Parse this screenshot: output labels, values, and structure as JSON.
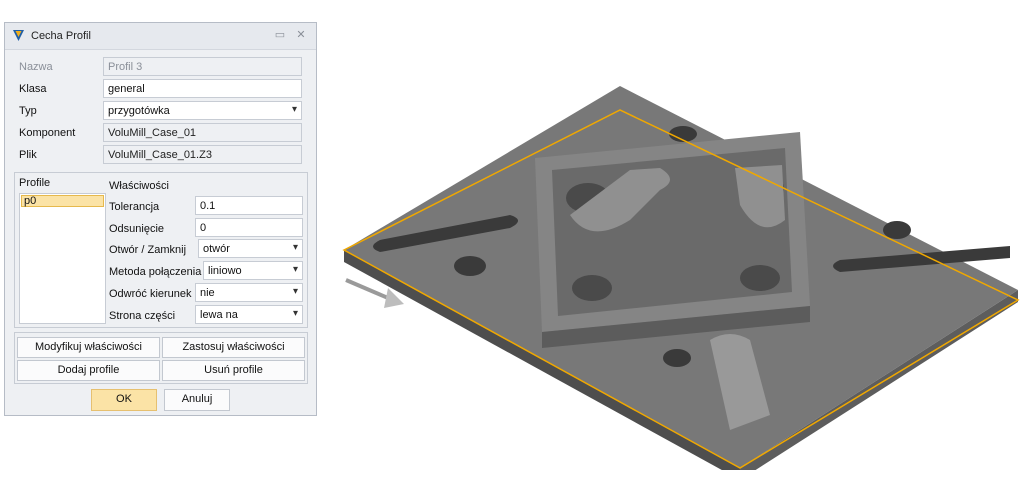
{
  "dialog": {
    "title": "Cecha Profil",
    "fields": {
      "nazwa_label": "Nazwa",
      "nazwa_value": "Profil 3",
      "klasa_label": "Klasa",
      "klasa_value": "general",
      "typ_label": "Typ",
      "typ_value": "przygotówka",
      "komponent_label": "Komponent",
      "komponent_value": "VoluMill_Case_01",
      "plik_label": "Plik",
      "plik_value": "VoluMill_Case_01.Z3"
    },
    "profiles": {
      "label": "Profile",
      "items": [
        "p0"
      ]
    },
    "properties": {
      "header": "Właściwości",
      "tolerancja_label": "Tolerancja",
      "tolerancja_value": "0.1",
      "odsuniecie_label": "Odsunięcie",
      "odsuniecie_value": "0",
      "otwor_label": "Otwór  / Zamknij",
      "otwor_value": "otwór",
      "metoda_label": "Metoda połączenia",
      "metoda_value": "liniowo",
      "odwroc_label": "Odwróć kierunek",
      "odwroc_value": "nie",
      "strona_label": "Strona części",
      "strona_value": "lewa na"
    },
    "buttons": {
      "modify": "Modyfikuj właściwości",
      "apply": "Zastosuj właściwości",
      "add": "Dodaj profile",
      "remove": "Usuń profile",
      "ok": "OK",
      "cancel": "Anuluj"
    }
  },
  "colors": {
    "accent": "#fbe3a6",
    "part_fill": "#757575",
    "profile_outline": "#f0a800"
  }
}
